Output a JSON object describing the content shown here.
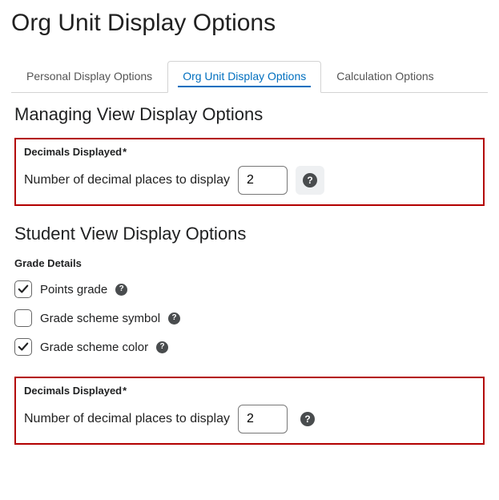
{
  "pageTitle": "Org Unit Display Options",
  "tabs": {
    "personal": "Personal Display Options",
    "orgUnit": "Org Unit Display Options",
    "calculation": "Calculation Options"
  },
  "managing": {
    "heading": "Managing View Display Options",
    "decimals": {
      "legend": "Decimals Displayed",
      "required": "*",
      "label": "Number of decimal places to display",
      "value": "2"
    }
  },
  "student": {
    "heading": "Student View Display Options",
    "gradeDetailsLabel": "Grade Details",
    "pointsGrade": {
      "label": "Points grade",
      "checked": true
    },
    "schemeSymbol": {
      "label": "Grade scheme symbol",
      "checked": false
    },
    "schemeColor": {
      "label": "Grade scheme color",
      "checked": true
    },
    "decimals": {
      "legend": "Decimals Displayed",
      "required": "*",
      "label": "Number of decimal places to display",
      "value": "2"
    }
  },
  "glyphs": {
    "help": "?"
  }
}
